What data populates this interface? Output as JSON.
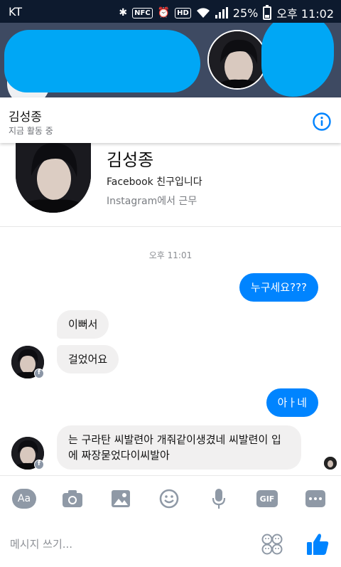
{
  "status_bar": {
    "carrier": "KT",
    "nfc_label": "NFC",
    "hd_label": "HD",
    "battery": "25%",
    "time": "오후 11:02"
  },
  "contact": {
    "name": "김성종",
    "status": "지금 활동 중"
  },
  "profile": {
    "name": "김성종",
    "line1": "Facebook 친구입니다",
    "line2": "Instagram에서 근무"
  },
  "thread": {
    "timestamp": "오후 11:01",
    "messages": [
      {
        "from": "me",
        "text": "누구세요???"
      },
      {
        "from": "them",
        "text": "이뻐서"
      },
      {
        "from": "them",
        "text": "걸었어요"
      },
      {
        "from": "me",
        "text": "아ㅏ네"
      },
      {
        "from": "them",
        "text": "는 구라탄 씨발련아 개줘같이생겼네 씨발련이 입에 짜장묻었다이씨발아"
      }
    ]
  },
  "composer": {
    "aa_label": "Aa",
    "gif_label": "GIF",
    "placeholder": "메시지 쓰기..."
  },
  "colors": {
    "accent": "#0084ff",
    "status_bar": "#0d1a2e",
    "heads_bg": "#3e4a62",
    "redaction": "#00a7f5",
    "incoming_bubble": "#f1f0f0"
  }
}
